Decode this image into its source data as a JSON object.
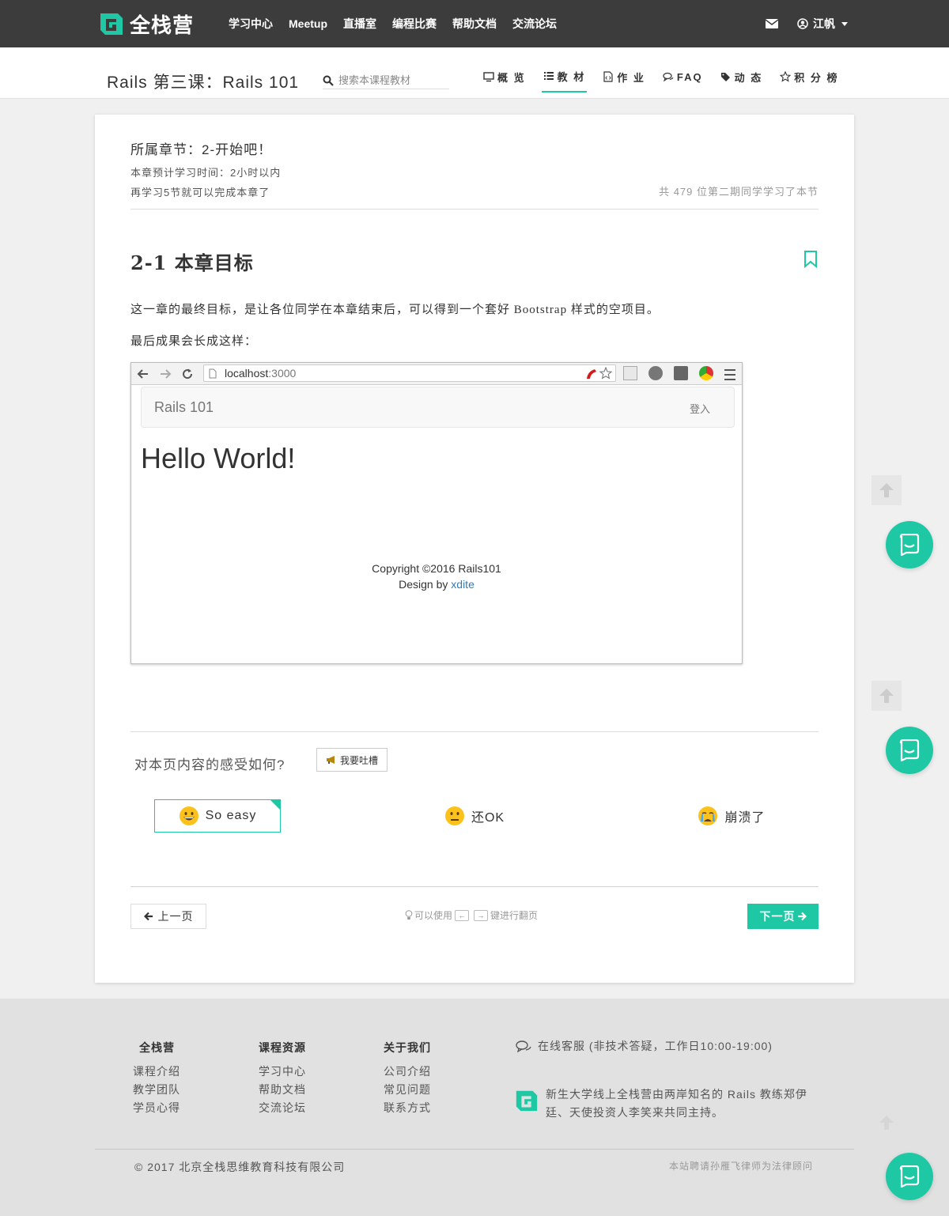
{
  "topnav": {
    "brand": "全栈营",
    "links": [
      "学习中心",
      "Meetup",
      "直播室",
      "编程比赛",
      "帮助文档",
      "交流论坛"
    ],
    "user_name": "江帆"
  },
  "course": {
    "title": "Rails 第三课：Rails 101",
    "search_placeholder": "搜索本课程教材",
    "tabs": [
      {
        "label": "概 览",
        "icon": "monitor-icon"
      },
      {
        "label": "教 材",
        "icon": "list-icon",
        "active": true
      },
      {
        "label": "作 业",
        "icon": "code-file-icon"
      },
      {
        "label": "FAQ",
        "icon": "comments-icon"
      },
      {
        "label": "动 态",
        "icon": "tags-icon"
      },
      {
        "label": "积 分 榜",
        "icon": "star-icon"
      }
    ]
  },
  "chapter": {
    "title": "所属章节：2-开始吧！",
    "time": "本章预计学习时间：2小时以内",
    "remain": "再学习5节就可以完成本章了",
    "learners": "共 479 位第二期同学学习了本节"
  },
  "section": {
    "title": "2-1 本章目标",
    "para1": "这一章的最终目标，是让各位同学在本章结束后，可以得到一个套好 Bootstrap 样式的空项目。",
    "para2": "最后成果会长成这样："
  },
  "screenshot": {
    "url_host": "localhost",
    "url_port": ":3000",
    "app_brand": "Rails 101",
    "app_login": "登入",
    "hello": "Hello World!",
    "copyright": "Copyright ©2016 Rails101",
    "design_prefix": "Design by ",
    "design_link": "xdite"
  },
  "feedback": {
    "question": "对本页内容的感受如何?",
    "tucao": "我要吐槽",
    "options": [
      {
        "label": "So easy",
        "emoji": "grinning-face-icon",
        "selected": true
      },
      {
        "label": "还OK",
        "emoji": "neutral-face-icon",
        "selected": false
      },
      {
        "label": "崩溃了",
        "emoji": "crying-face-icon",
        "selected": false
      }
    ]
  },
  "pager": {
    "prev": "上一页",
    "hint_prefix": "可以使用",
    "key_left": "←",
    "key_right": "→",
    "hint_suffix": "键进行翻页",
    "next": "下一页"
  },
  "footer": {
    "cols": [
      {
        "title": "全栈营",
        "items": [
          "课程介绍",
          "教学团队",
          "学员心得"
        ]
      },
      {
        "title": "课程资源",
        "items": [
          "学习中心",
          "帮助文档",
          "交流论坛"
        ]
      },
      {
        "title": "关于我们",
        "items": [
          "公司介绍",
          "常见问题",
          "联系方式"
        ]
      }
    ],
    "service": "在线客服 (非技术答疑，工作日10:00-19:00)",
    "desc": "新生大学线上全栈营由两岸知名的 Rails 教练郑伊廷、天使投资人李笑来共同主持。",
    "copyright": "© 2017 北京全栈思维教育科技有限公司",
    "lawyer": "本站聘请孙雁飞律师为法律顾问"
  },
  "colors": {
    "accent": "#1ec8a5",
    "topnav_bg": "#3c3c3c",
    "footer_bg": "#e1e1e1"
  }
}
